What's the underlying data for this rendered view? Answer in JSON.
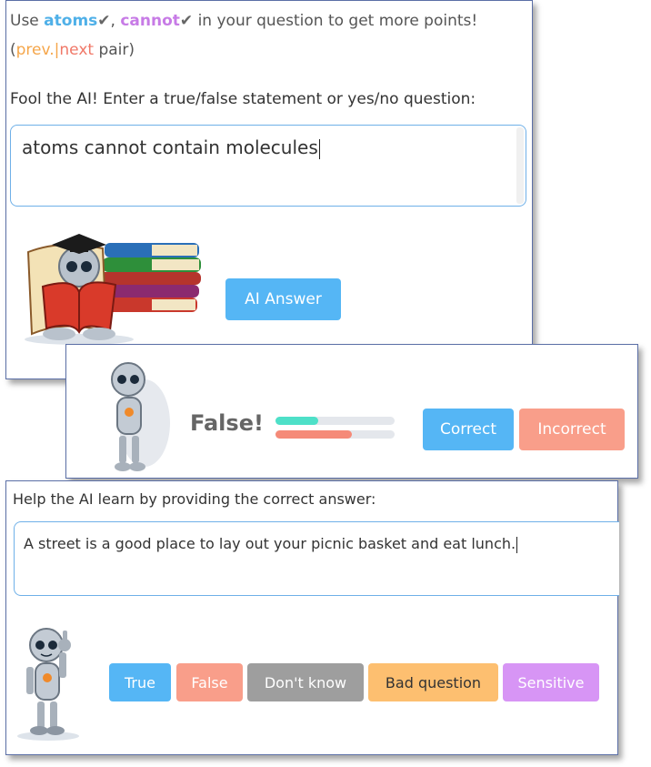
{
  "hint": {
    "prefix": "Use ",
    "keyword1": "atoms",
    "check": "✔",
    "comma": ", ",
    "keyword2": "cannot",
    "suffix": " in your question to get more points!"
  },
  "nav": {
    "open": "(",
    "prev": "prev.",
    "sep": "|",
    "next": "next",
    "close": " pair)"
  },
  "prompt": "Fool the AI! Enter a true/false statement or yes/no question:",
  "question_value": "atoms cannot contain molecules",
  "ai_answer_label": "AI Answer",
  "result": {
    "verdict": "False!",
    "true_fraction": 0.36,
    "false_fraction": 0.64,
    "correct_label": "Correct",
    "incorrect_label": "Incorrect"
  },
  "help": {
    "prompt": "Help the AI learn by providing the correct answer:",
    "answer_value": "A street is a good place to lay out your picnic basket and eat lunch.",
    "buttons": {
      "true": "True",
      "false": "False",
      "dont_know": "Don't know",
      "bad_question": "Bad question",
      "sensitive": "Sensitive"
    }
  },
  "colors": {
    "accent_blue": "#55b6f5",
    "salmon": "#f99e8a",
    "gray": "#9e9e9e",
    "orange": "#fdbf70",
    "violet": "#d795f5",
    "teal": "#4ee0c8"
  }
}
